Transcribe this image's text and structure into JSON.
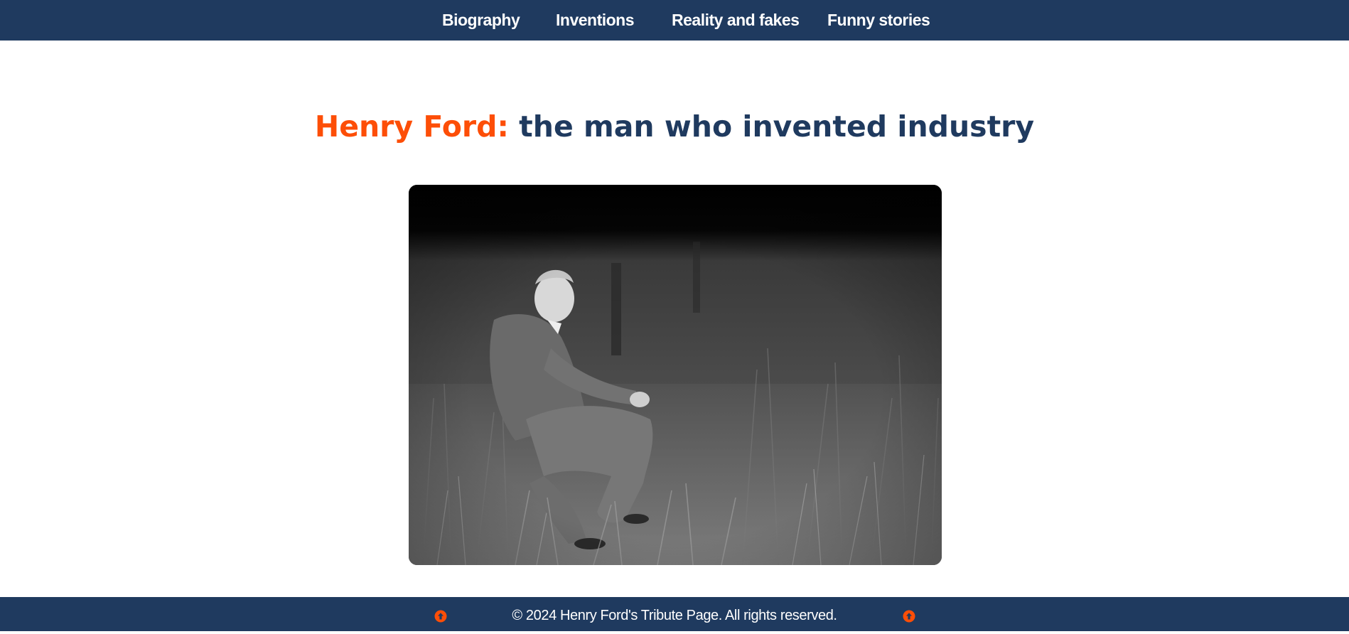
{
  "nav": {
    "items": [
      {
        "label": "Biography"
      },
      {
        "label": "Inventions"
      },
      {
        "label": "Reality and fakes"
      },
      {
        "label": "Funny stories"
      }
    ]
  },
  "header": {
    "title_accent": "Henry Ford:",
    "title_rest": " the man who invented industry"
  },
  "main": {
    "photo_icon": "black-and-white-portrait-photo"
  },
  "footer": {
    "copyright": "© 2024 Henry Ford's Tribute Page. All rights reserved.",
    "left_icon": "arrow-up-circle-icon",
    "right_icon": "arrow-up-circle-icon"
  },
  "colors": {
    "nav_bg": "#1f3a5f",
    "accent": "#fd4e07",
    "title": "#1f3a5f",
    "footer_bg": "#1f3a5f"
  }
}
